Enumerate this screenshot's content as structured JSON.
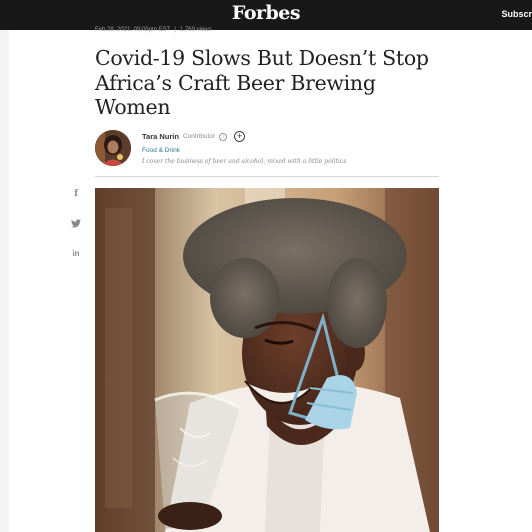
{
  "header": {
    "logo": "Forbes",
    "subscribe_label": "Subscr"
  },
  "article": {
    "date": "Feb 28, 2021, 09:05pm EST",
    "separator": "|",
    "views": "1,769 views",
    "headline": "Covid-19 Slows But Doesn’t Stop Africa’s Craft Beer Brewing Women"
  },
  "author": {
    "name": "Tara Nurin",
    "role": "Contributor",
    "info_icon": "ⓘ",
    "follow_icon": "+",
    "category": "Food & Drink",
    "bio": "I cover the business of beer and alcohol, mixed with a little politics"
  },
  "social": {
    "facebook_icon": "f",
    "twitter_icon": "🐦",
    "linkedin_icon": "in"
  },
  "colors": {
    "topbar": "#181818",
    "category_link": "#2a7a8c",
    "headline": "#222222"
  }
}
